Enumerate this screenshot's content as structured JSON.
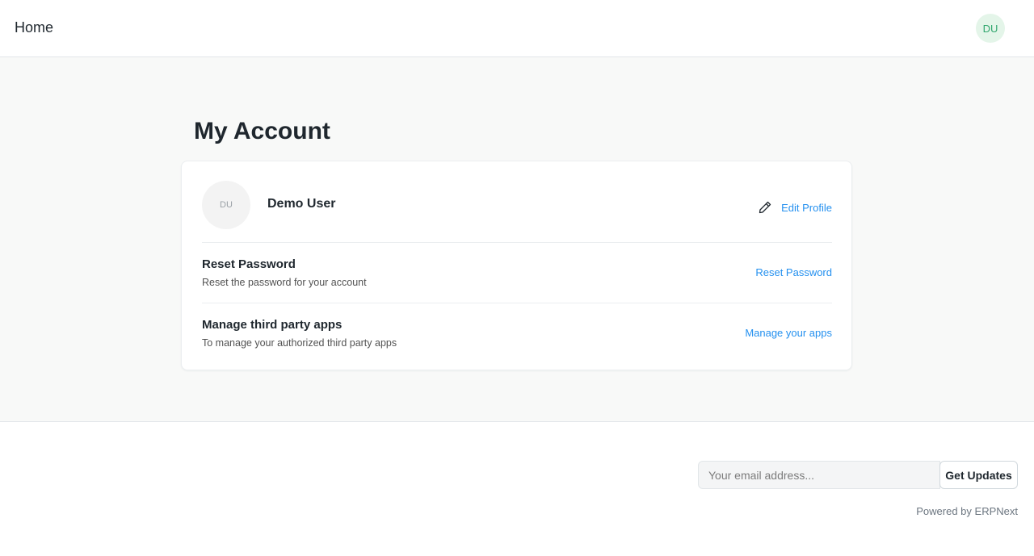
{
  "navbar": {
    "home_label": "Home",
    "avatar_initials": "DU"
  },
  "page": {
    "title": "My Account"
  },
  "profile": {
    "avatar_initials": "DU",
    "name": "Demo User",
    "edit_label": "Edit Profile",
    "edit_icon": "pencil-icon"
  },
  "reset_password": {
    "title": "Reset Password",
    "description": "Reset the password for your account",
    "link_label": "Reset Password"
  },
  "third_party_apps": {
    "title": "Manage third party apps",
    "description": "To manage your authorized third party apps",
    "link_label": "Manage your apps"
  },
  "footer": {
    "email_placeholder": "Your email address...",
    "email_value": "",
    "subscribe_label": "Get Updates",
    "powered_by": "Powered by ERPNext"
  },
  "colors": {
    "link": "#2490ef",
    "avatar_bg": "#e4f5e9",
    "avatar_text": "#30a66d",
    "page_bg": "#f8f9f8"
  }
}
